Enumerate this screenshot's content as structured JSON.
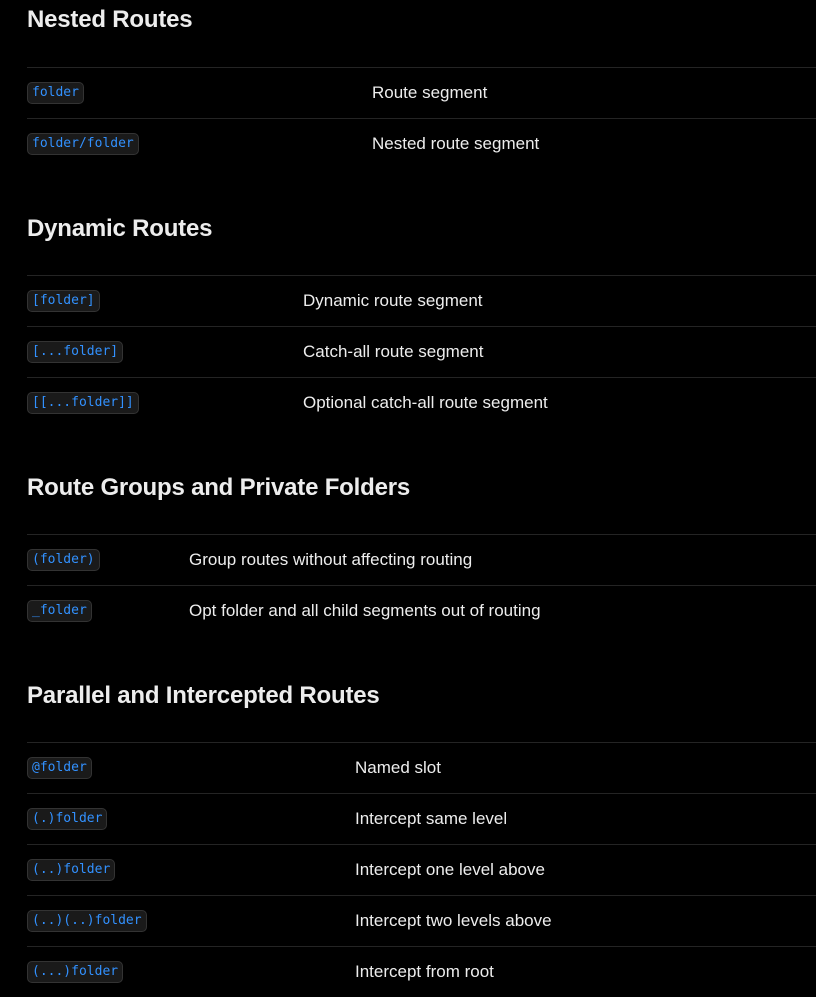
{
  "sections": [
    {
      "title": "Nested Routes",
      "rows": [
        {
          "code": "folder",
          "desc": "Route segment"
        },
        {
          "code": "folder/folder",
          "desc": "Nested route segment"
        }
      ]
    },
    {
      "title": "Dynamic Routes",
      "rows": [
        {
          "code": "[folder]",
          "desc": "Dynamic route segment"
        },
        {
          "code": "[...folder]",
          "desc": "Catch-all route segment"
        },
        {
          "code": "[[...folder]]",
          "desc": "Optional catch-all route segment"
        }
      ]
    },
    {
      "title": "Route Groups and Private Folders",
      "rows": [
        {
          "code": "(folder)",
          "desc": "Group routes without affecting routing"
        },
        {
          "code": "_folder",
          "desc": "Opt folder and all child segments out of routing"
        }
      ]
    },
    {
      "title": "Parallel and Intercepted Routes",
      "rows": [
        {
          "code": "@folder",
          "desc": "Named slot"
        },
        {
          "code": "(.)folder",
          "desc": "Intercept same level"
        },
        {
          "code": "(..)folder",
          "desc": "Intercept one level above"
        },
        {
          "code": "(..)(..)folder",
          "desc": "Intercept two levels above"
        },
        {
          "code": "(...)folder",
          "desc": "Intercept from root"
        }
      ]
    }
  ],
  "colors": {
    "background": "#000000",
    "text": "#ededed",
    "code": "#3291ff",
    "chip_bg": "#1a1a1a",
    "border": "#242424"
  }
}
